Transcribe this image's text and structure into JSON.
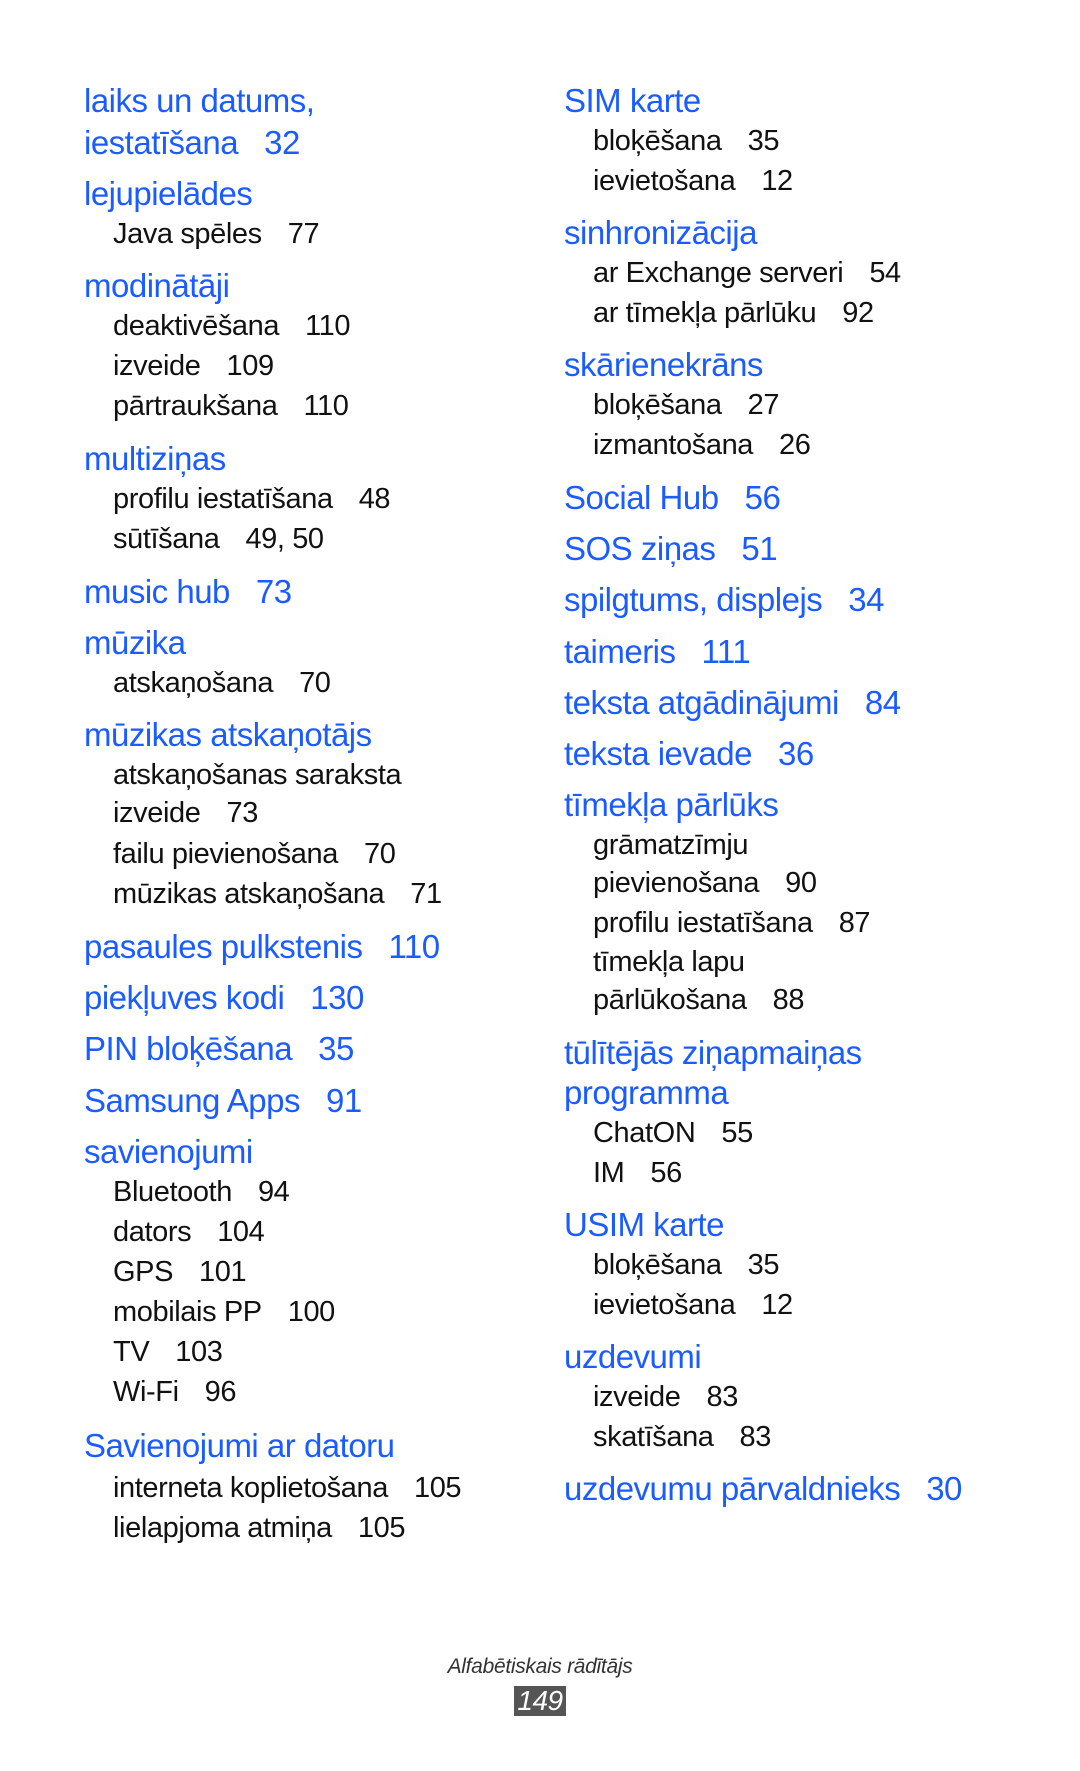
{
  "left_column": {
    "lines": [
      {
        "text": "laiks un datums,",
        "num": ""
      },
      {
        "text": "iestatīšana",
        "num": "32"
      },
      {
        "text": "lejupielādes",
        "num": ""
      },
      {
        "text": "Java spēles",
        "num": "77"
      },
      {
        "text": "modinātāji",
        "num": ""
      },
      {
        "text": "deaktivēšana",
        "num": "110"
      },
      {
        "text": "izveide",
        "num": "109"
      },
      {
        "text": "pārtraukšana",
        "num": "110"
      },
      {
        "text": "multiziņas",
        "num": ""
      },
      {
        "text": "profilu iestatīšana",
        "num": "48"
      },
      {
        "text": "sūtīšana",
        "num": "49, 50"
      },
      {
        "text": "music hub",
        "num": "73"
      },
      {
        "text": "mūzika",
        "num": ""
      },
      {
        "text": "atskaņošana",
        "num": "70"
      },
      {
        "text": "mūzikas atskaņotājs",
        "num": ""
      },
      {
        "text": "atskaņošanas saraksta",
        "num": ""
      },
      {
        "text": "izveide",
        "num": "73"
      },
      {
        "text": "failu pievienošana",
        "num": "70"
      },
      {
        "text": "mūzikas atskaņošana",
        "num": "71"
      },
      {
        "text": "pasaules pulkstenis",
        "num": "110"
      },
      {
        "text": "piekļuves kodi",
        "num": "130"
      },
      {
        "text": "PIN bloķēšana",
        "num": "35"
      },
      {
        "text": "Samsung Apps",
        "num": "91"
      },
      {
        "text": "savienojumi",
        "num": ""
      },
      {
        "text": "Bluetooth",
        "num": "94"
      },
      {
        "text": "dators",
        "num": "104"
      },
      {
        "text": "GPS",
        "num": "101"
      },
      {
        "text": "mobilais PP",
        "num": "100"
      },
      {
        "text": "TV",
        "num": "103"
      },
      {
        "text": "Wi-Fi",
        "num": "96"
      },
      {
        "text": "Savienojumi ar datoru",
        "num": ""
      },
      {
        "text": "interneta koplietošana",
        "num": "105"
      },
      {
        "text": "lielapjoma atmiņa",
        "num": "105"
      }
    ]
  },
  "right_column": {
    "lines": [
      {
        "text": "SIM karte",
        "num": ""
      },
      {
        "text": "bloķēšana",
        "num": "35"
      },
      {
        "text": "ievietošana",
        "num": "12"
      },
      {
        "text": "sinhronizācija",
        "num": ""
      },
      {
        "text": "ar Exchange serveri",
        "num": "54"
      },
      {
        "text": "ar tīmekļa pārlūku",
        "num": "92"
      },
      {
        "text": "skārienekrāns",
        "num": ""
      },
      {
        "text": "bloķēšana",
        "num": "27"
      },
      {
        "text": "izmantošana",
        "num": "26"
      },
      {
        "text": "Social Hub",
        "num": "56"
      },
      {
        "text": "SOS ziņas",
        "num": "51"
      },
      {
        "text": "spilgtums, displejs",
        "num": "34"
      },
      {
        "text": "taimeris",
        "num": "111"
      },
      {
        "text": "teksta atgādinājumi",
        "num": "84"
      },
      {
        "text": "teksta ievade",
        "num": "36"
      },
      {
        "text": "tīmekļa pārlūks",
        "num": ""
      },
      {
        "text": "grāmatzīmju",
        "num": ""
      },
      {
        "text": "pievienošana",
        "num": "90"
      },
      {
        "text": "profilu iestatīšana",
        "num": "87"
      },
      {
        "text": "tīmekļa lapu",
        "num": ""
      },
      {
        "text": "pārlūkošana",
        "num": "88"
      },
      {
        "text": "tūlītējās ziņapmaiņas",
        "num": ""
      },
      {
        "text": "programma",
        "num": ""
      },
      {
        "text": "ChatON",
        "num": "55"
      },
      {
        "text": "IM",
        "num": "56"
      },
      {
        "text": "USIM karte",
        "num": ""
      },
      {
        "text": "bloķēšana",
        "num": "35"
      },
      {
        "text": "ievietošana",
        "num": "12"
      },
      {
        "text": "uzdevumi",
        "num": ""
      },
      {
        "text": "izveide",
        "num": "83"
      },
      {
        "text": "skatīšana",
        "num": "83"
      },
      {
        "text": "uzdevumu pārvaldnieks",
        "num": "30"
      }
    ]
  },
  "footer": {
    "section_title": "Alfabētiskais rādītājs",
    "page_number": "149"
  },
  "colors": {
    "heading": "#1a5cff",
    "subentry": "#111111",
    "page_badge": "#555555"
  }
}
